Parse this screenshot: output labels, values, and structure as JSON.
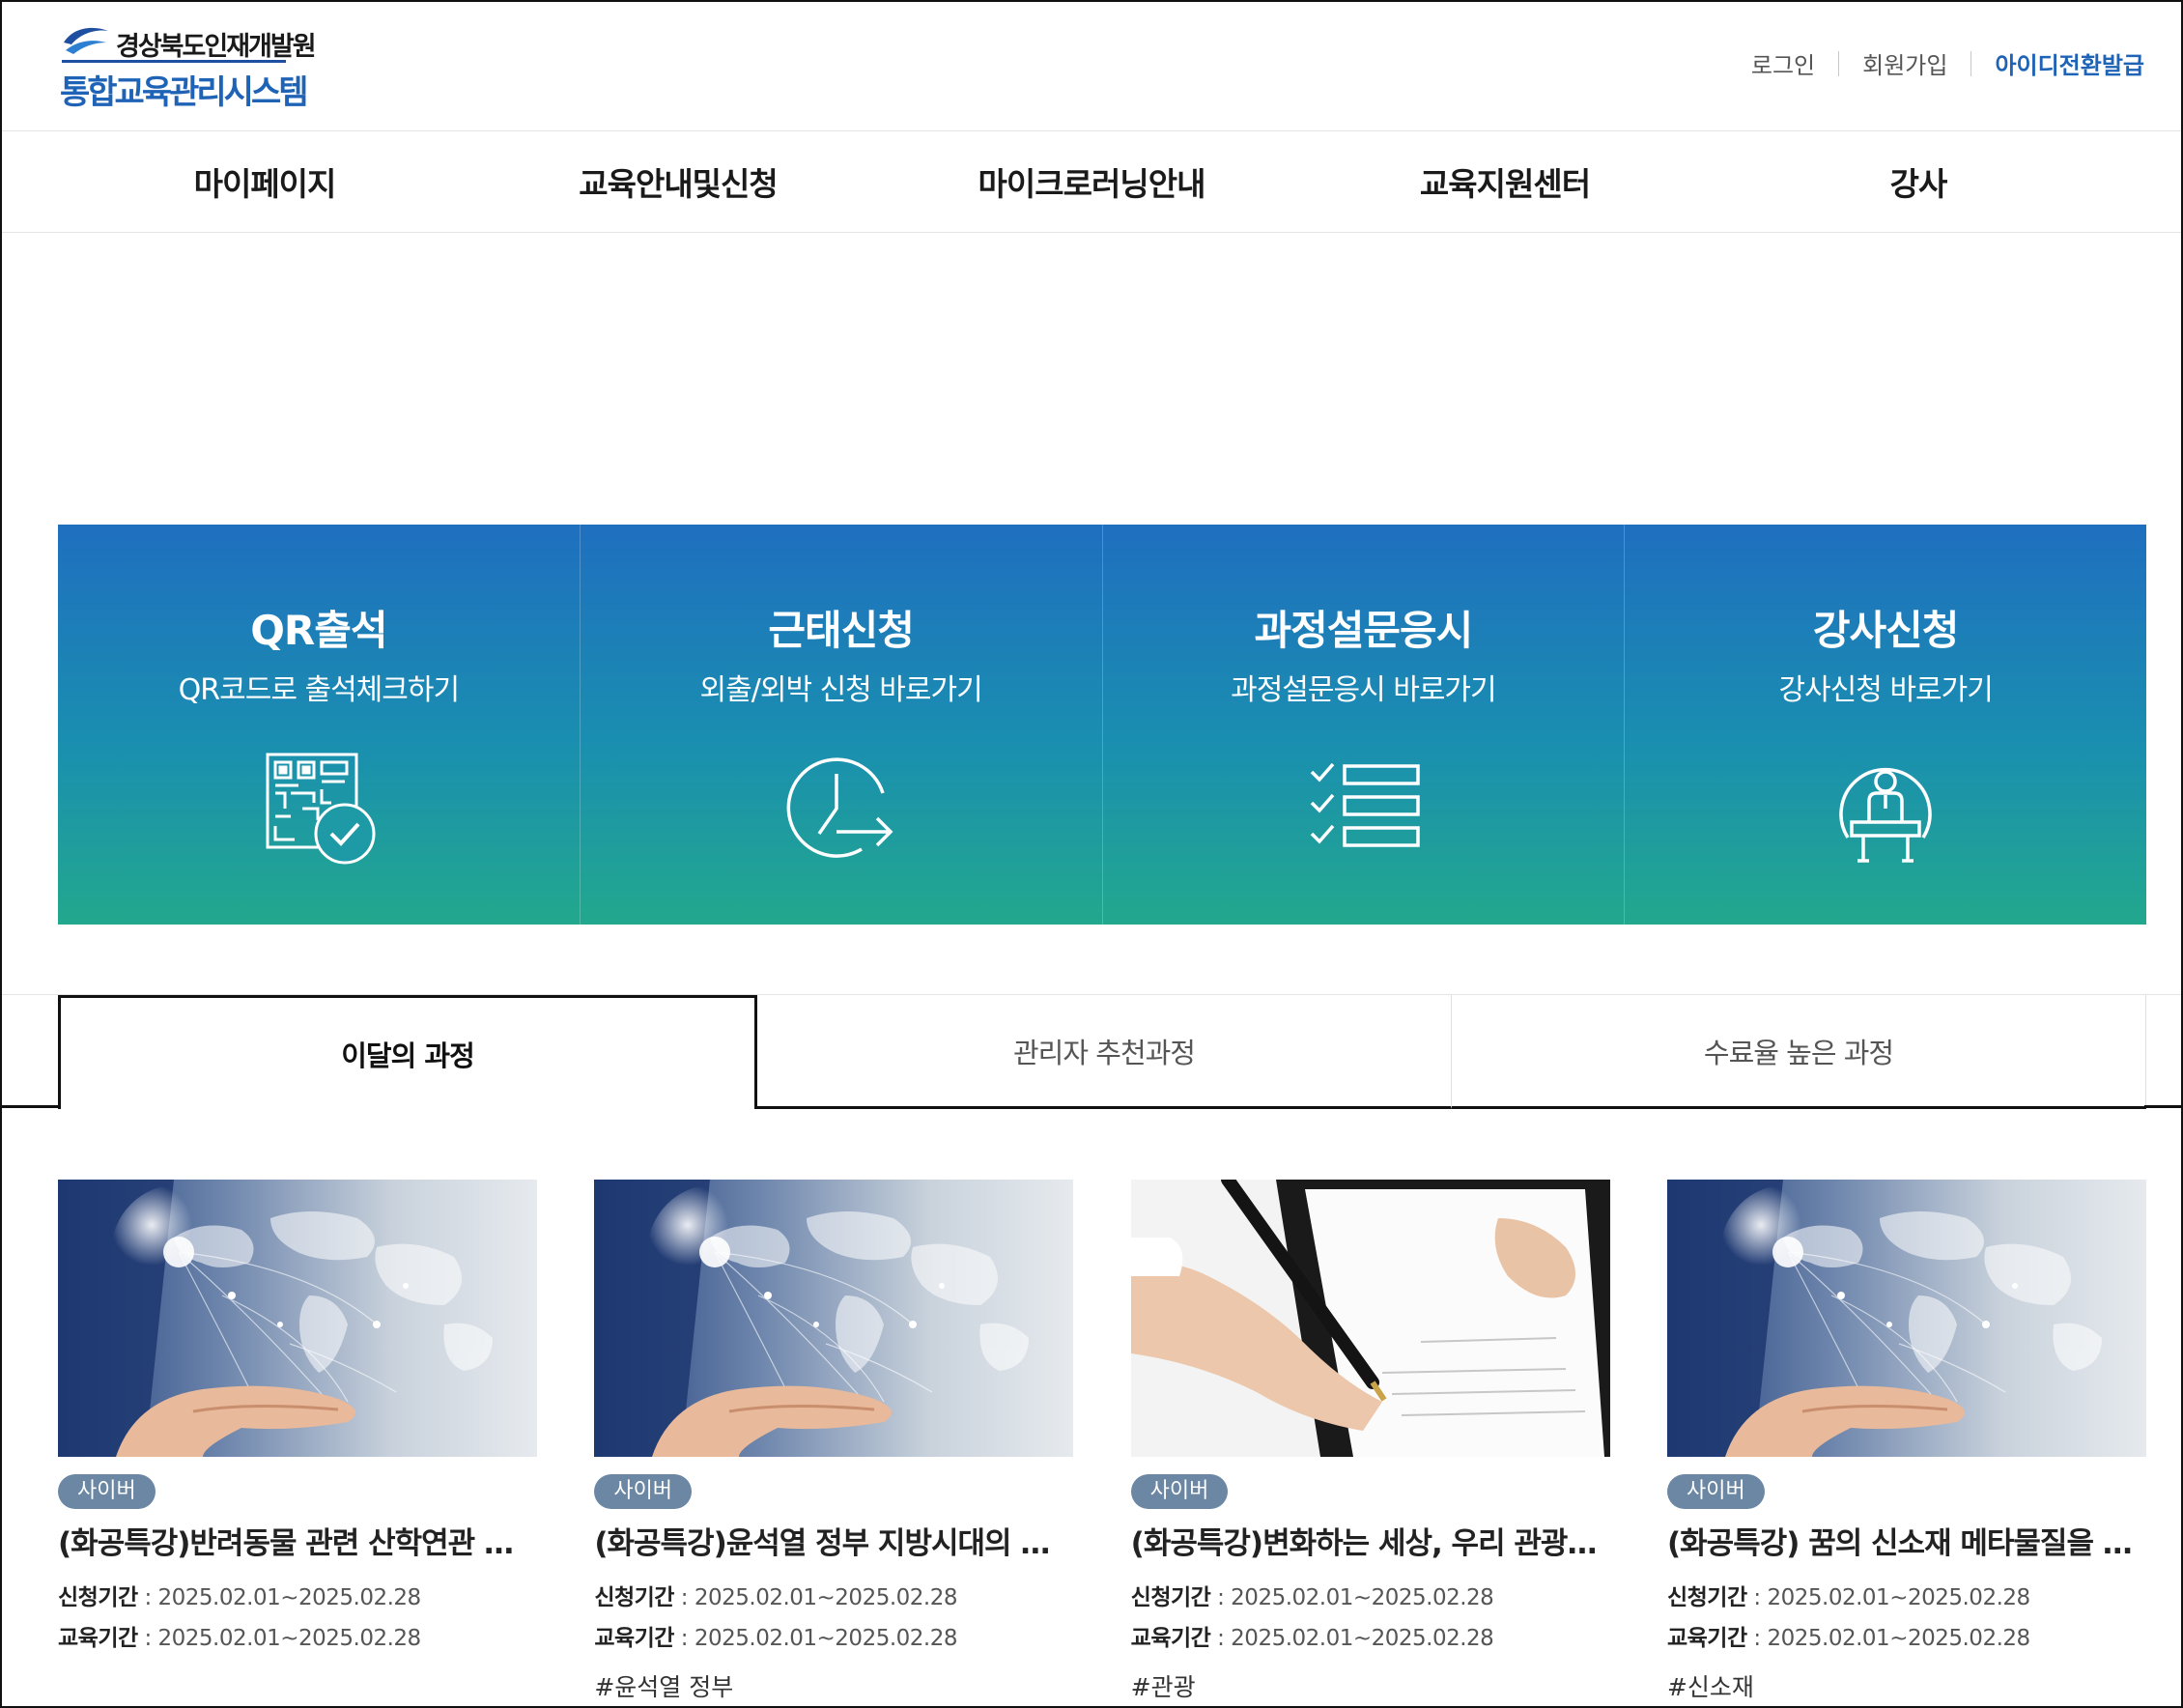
{
  "header": {
    "org_name": "경상북도인재개발원",
    "system_name": "통합교육관리시스템",
    "util": {
      "login": "로그인",
      "join": "회원가입",
      "id_convert": "아이디전환발급"
    }
  },
  "gnb": [
    "마이페이지",
    "교육안내및신청",
    "마이크로러닝안내",
    "교육지원센터",
    "강사"
  ],
  "quick": [
    {
      "title": "QR출석",
      "subtitle": "QR코드로 출석체크하기",
      "icon": "qr-check-icon"
    },
    {
      "title": "근태신청",
      "subtitle": "외출/외박 신청 바로가기",
      "icon": "clock-arrow-icon"
    },
    {
      "title": "과정설문응시",
      "subtitle": "과정설문응시 바로가기",
      "icon": "checklist-icon"
    },
    {
      "title": "강사신청",
      "subtitle": "강사신청 바로가기",
      "icon": "lecturer-podium-icon"
    }
  ],
  "tabs": [
    "이달의 과정",
    "관리자 추천과정",
    "수료율 높은 과정"
  ],
  "cards": [
    {
      "badge": "사이버",
      "title": "(화공특강)반려동물 관련 산학연관 현...",
      "apply_label": "신청기간",
      "apply_period": "2025.02.01~2025.02.28",
      "edu_label": "교육기간",
      "edu_period": "2025.02.01~2025.02.28",
      "tag": "",
      "image": "world-map-hand"
    },
    {
      "badge": "사이버",
      "title": "(화공특강)윤석열 정부 지방시대의 비...",
      "apply_label": "신청기간",
      "apply_period": "2025.02.01~2025.02.28",
      "edu_label": "교육기간",
      "edu_period": "2025.02.01~2025.02.28",
      "tag": "#윤석열 정부",
      "image": "world-map-hand"
    },
    {
      "badge": "사이버",
      "title": "(화공특강)변화하는 세상, 우리 관광이 ...",
      "apply_label": "신청기간",
      "apply_period": "2025.02.01~2025.02.28",
      "edu_label": "교육기간",
      "edu_period": "2025.02.01~2025.02.28",
      "tag": "#관광",
      "image": "hand-writing"
    },
    {
      "badge": "사이버",
      "title": "(화공특강) 꿈의 신소재 메타물질을 이...",
      "apply_label": "신청기간",
      "apply_period": "2025.02.01~2025.02.28",
      "edu_label": "교육기간",
      "edu_period": "2025.02.01~2025.02.28",
      "tag": "#신소재",
      "image": "world-map-hand"
    }
  ],
  "colors": {
    "brand": "#1f63b7",
    "quick_top": "#1f6fbf",
    "quick_bottom": "#22a88d",
    "badge": "#6b87a3"
  }
}
